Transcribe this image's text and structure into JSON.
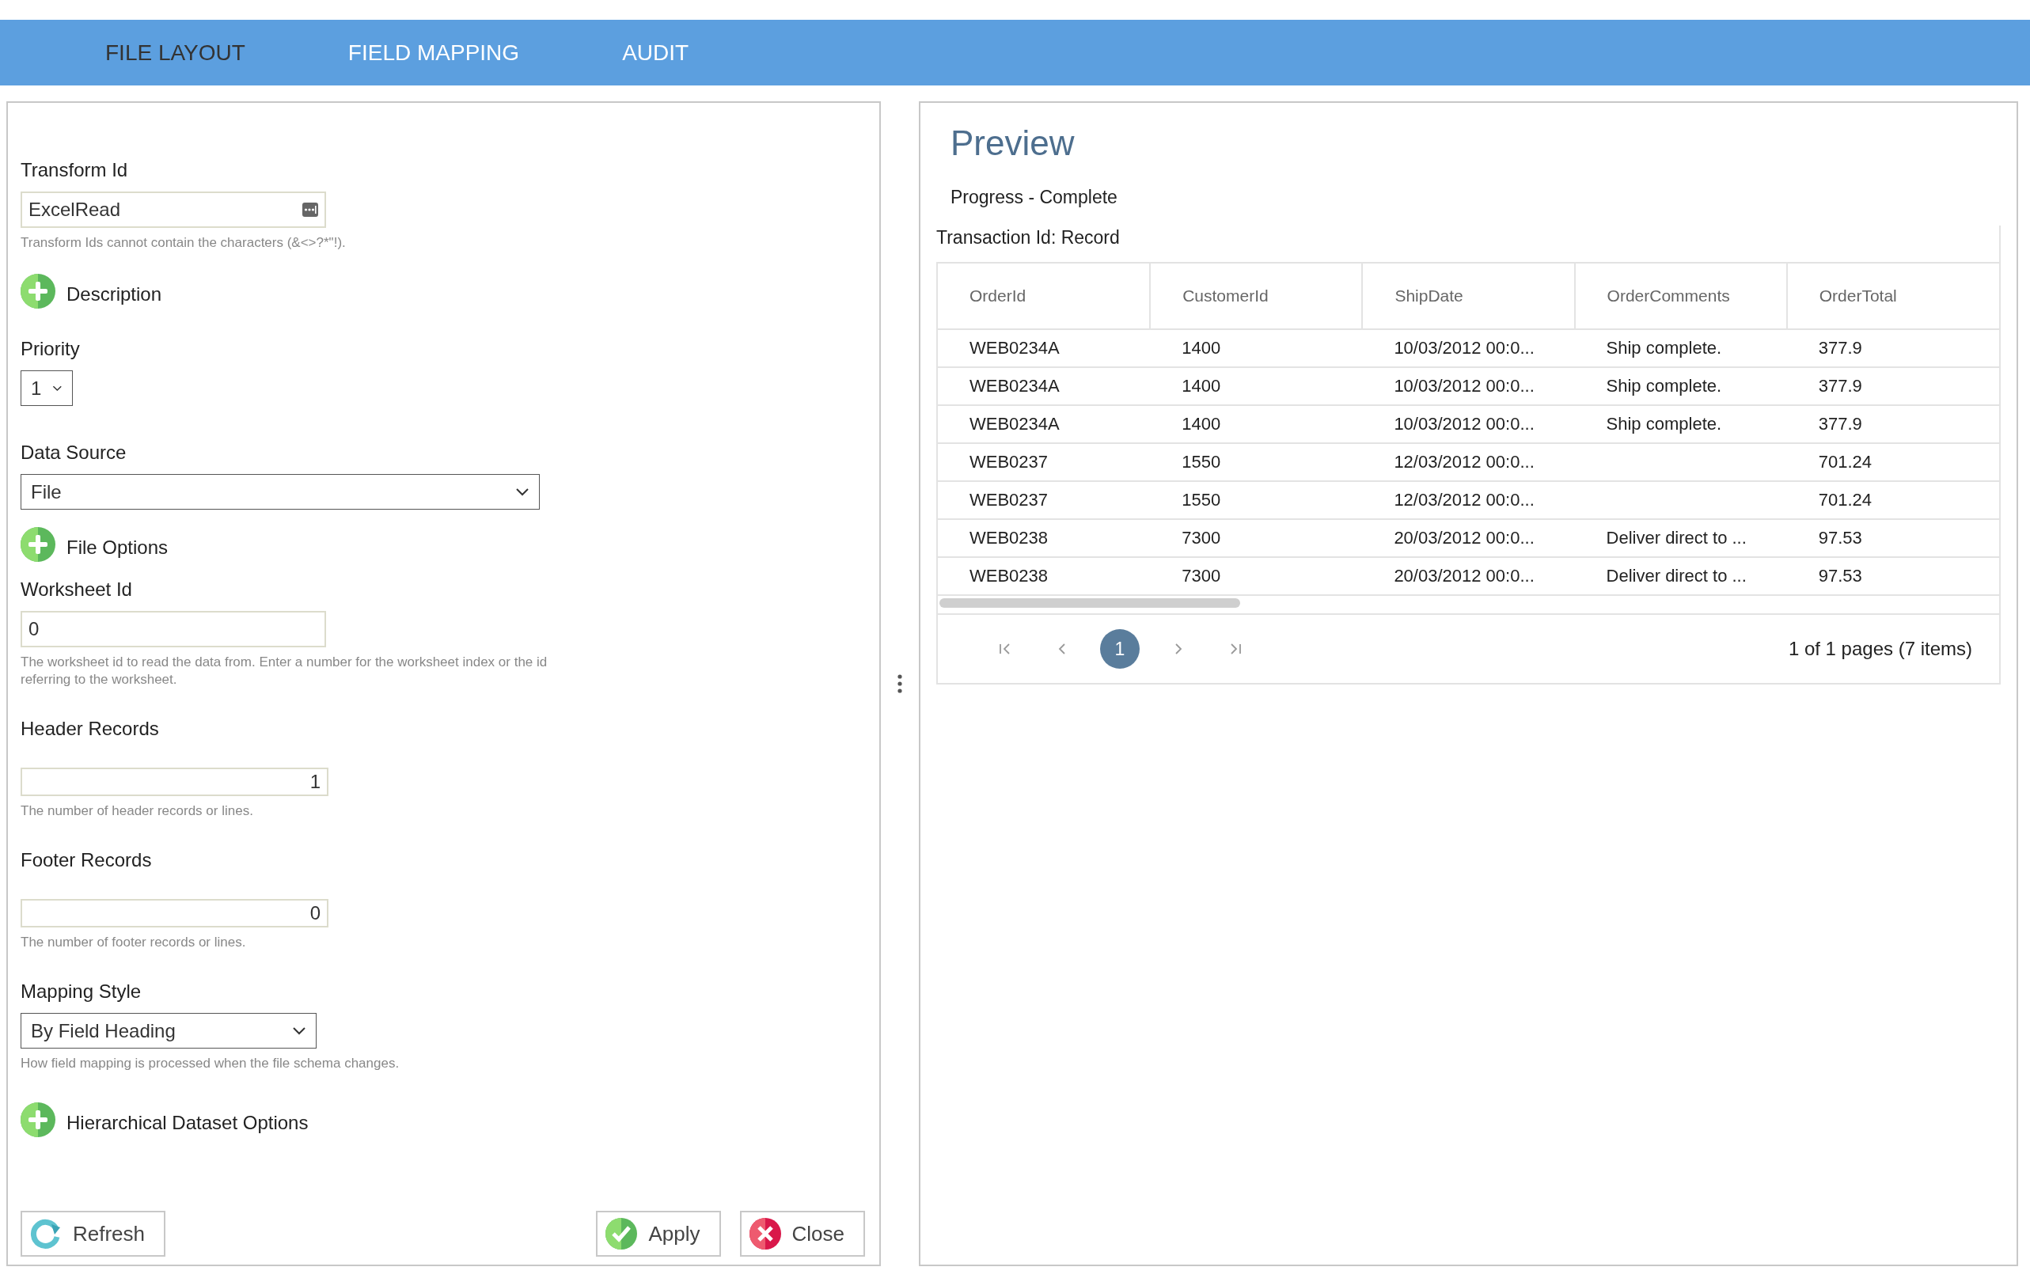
{
  "tabs": [
    {
      "label": "FILE LAYOUT",
      "selected": true
    },
    {
      "label": "FIELD MAPPING",
      "selected": false
    },
    {
      "label": "AUDIT",
      "selected": false
    }
  ],
  "form": {
    "items": [
      {
        "kind": "text",
        "label": "Transform Id",
        "value": "ExcelRead",
        "hint": "Transform Ids cannot contain the characters (&<>?*\"!)."
      },
      {
        "kind": "expander",
        "label": "Description",
        "expanded": false
      },
      {
        "kind": "select",
        "label": "Priority",
        "value": "1"
      },
      {
        "kind": "select",
        "label": "Data Source",
        "value": "File"
      },
      {
        "kind": "expander",
        "label": "File Options",
        "expanded": false
      },
      {
        "kind": "text",
        "label": "Worksheet Id",
        "value": "0",
        "hint": "The worksheet id to read the data from. Enter a number for the worksheet index or the id referring to the worksheet."
      },
      {
        "kind": "number",
        "label": "Header Records",
        "value": "1",
        "hint": "The number of header records or lines."
      },
      {
        "kind": "number",
        "label": "Footer Records",
        "value": "0",
        "hint": "The number of footer records or lines."
      },
      {
        "kind": "select",
        "label": "Mapping Style",
        "value": "By Field Heading",
        "hint": "How field mapping is processed when the file schema changes."
      },
      {
        "kind": "expander",
        "label": "Hierarchical Dataset Options",
        "expanded": false
      }
    ],
    "buttons": [
      {
        "kind": "refresh",
        "label": "Refresh"
      },
      {
        "kind": "apply",
        "label": "Apply"
      },
      {
        "kind": "close",
        "label": "Close"
      }
    ]
  },
  "preview": {
    "title": "Preview",
    "progress": "Progress - Complete",
    "caption": "Transaction Id: Record",
    "columns": [
      "OrderId",
      "CustomerId",
      "ShipDate",
      "OrderComments",
      "OrderTotal"
    ],
    "rows": [
      [
        "WEB0234A",
        "1400",
        "10/03/2012 00:0...",
        "Ship complete.",
        "377.9"
      ],
      [
        "WEB0234A",
        "1400",
        "10/03/2012 00:0...",
        "Ship complete.",
        "377.9"
      ],
      [
        "WEB0234A",
        "1400",
        "10/03/2012 00:0...",
        "Ship complete.",
        "377.9"
      ],
      [
        "WEB0237",
        "1550",
        "12/03/2012 00:0...",
        null,
        "701.24"
      ],
      [
        "WEB0237",
        "1550",
        "12/03/2012 00:0...",
        null,
        "701.24"
      ],
      [
        "WEB0238",
        "7300",
        "20/03/2012 00:0...",
        "Deliver direct to ...",
        "97.53"
      ],
      [
        "WEB0238",
        "7300",
        "20/03/2012 00:0...",
        "Deliver direct to ...",
        "97.53"
      ]
    ],
    "pages": [
      {
        "label": "1",
        "selected": true
      }
    ],
    "summary": "1 of 1 pages (7 items)"
  }
}
